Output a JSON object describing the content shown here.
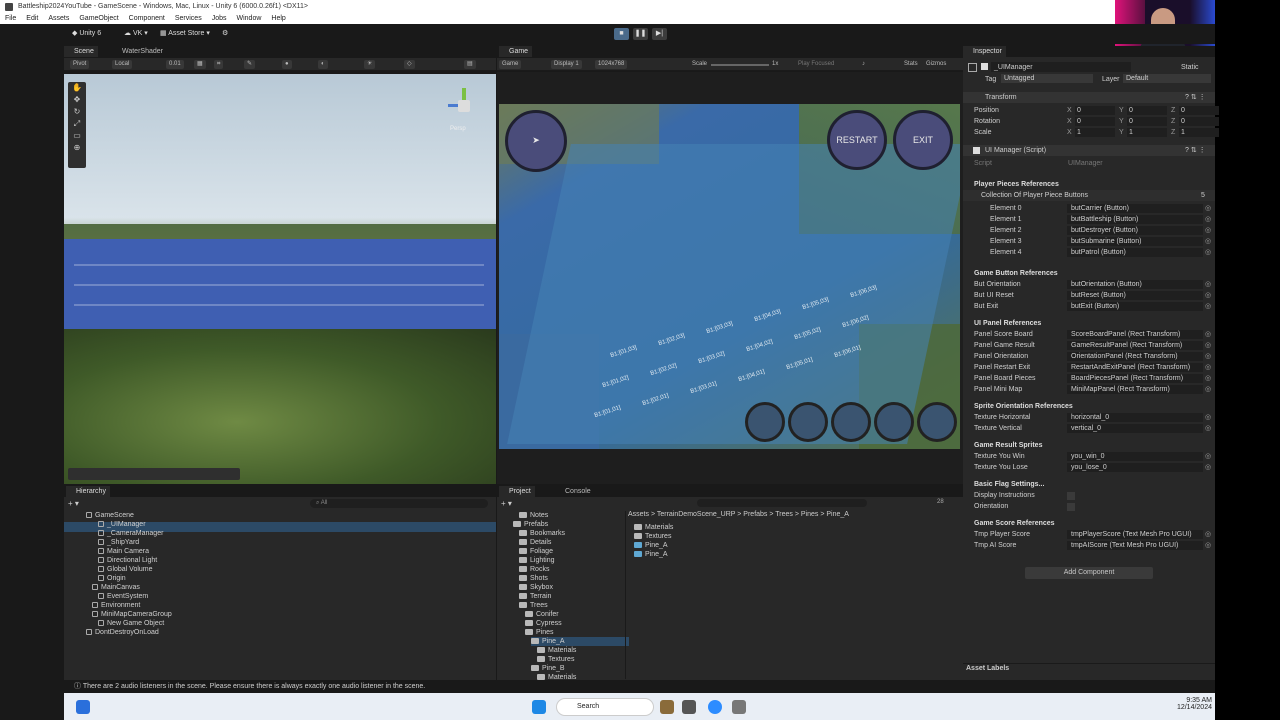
{
  "window": {
    "title": "Battleship2024YouTube - GameScene - Windows, Mac, Linux - Unity 6 (6000.0.26f1) <DX11>"
  },
  "menu": [
    "File",
    "Edit",
    "Assets",
    "GameObject",
    "Component",
    "Services",
    "Jobs",
    "Window",
    "Help"
  ],
  "toolbar": {
    "unity_label": "Unity 6",
    "account_label": "VK",
    "asset_store_label": "Asset Store"
  },
  "scene_tabs": {
    "scene": "Scene",
    "water_shader": "WaterShader"
  },
  "scene_toolbar": {
    "pivot": "Pivot",
    "local": "Local",
    "snap": "0.01",
    "persp": "Persp"
  },
  "game_tab": "Game",
  "game_toolbar": {
    "mode": "Game",
    "display": "Display 1",
    "resolution": "1024x768",
    "scale_label": "Scale",
    "scale_value": "1x",
    "play_focused": "Play Focused",
    "stats": "Stats",
    "gizmos": "Gizmos"
  },
  "game_ui": {
    "restart_label": "RESTART",
    "exit_label": "EXIT"
  },
  "grid_labels": [
    "B1:[01,01]",
    "B1:[02,01]",
    "B1:[03,01]",
    "B1:[04,01]",
    "B1:[05,01]",
    "B1:[06,01]",
    "B1:[01,02]",
    "B1:[02,02]",
    "B1:[03,02]",
    "B1:[04,02]",
    "B1:[05,02]",
    "B1:[06,02]",
    "B1:[01,03]",
    "B1:[02,03]",
    "B1:[03,03]",
    "B1:[04,03]",
    "B1:[05,03]",
    "B1:[06,03]"
  ],
  "hierarchy": {
    "tab": "Hierarchy",
    "search_placeholder": "All",
    "items": [
      {
        "label": "GameScene",
        "indent": 0
      },
      {
        "label": "_UIManager",
        "indent": 2
      },
      {
        "label": "_CameraManager",
        "indent": 2
      },
      {
        "label": "_ShipYard",
        "indent": 2
      },
      {
        "label": "Main Camera",
        "indent": 2
      },
      {
        "label": "Directional Light",
        "indent": 2
      },
      {
        "label": "Global Volume",
        "indent": 2
      },
      {
        "label": "Origin",
        "indent": 2
      },
      {
        "label": "MainCanvas",
        "indent": 1
      },
      {
        "label": "EventSystem",
        "indent": 2
      },
      {
        "label": "Environment",
        "indent": 1
      },
      {
        "label": "MiniMapCameraGroup",
        "indent": 1
      },
      {
        "label": "New Game Object",
        "indent": 2
      },
      {
        "label": "DontDestroyOnLoad",
        "indent": 0
      }
    ]
  },
  "project": {
    "tab": "Project",
    "console_tab": "Console",
    "breadcrumb": "Assets > TerrainDemoScene_URP > Prefabs > Trees > Pines > Pine_A",
    "tree": [
      {
        "label": "Notes",
        "indent": 2
      },
      {
        "label": "Prefabs",
        "indent": 1
      },
      {
        "label": "Bookmarks",
        "indent": 2
      },
      {
        "label": "Details",
        "indent": 2
      },
      {
        "label": "Foliage",
        "indent": 2
      },
      {
        "label": "Lighting",
        "indent": 2
      },
      {
        "label": "Rocks",
        "indent": 2
      },
      {
        "label": "Shots",
        "indent": 2
      },
      {
        "label": "Skybox",
        "indent": 2
      },
      {
        "label": "Terrain",
        "indent": 2
      },
      {
        "label": "Trees",
        "indent": 2
      },
      {
        "label": "Conifer",
        "indent": 3
      },
      {
        "label": "Cypress",
        "indent": 3
      },
      {
        "label": "Pines",
        "indent": 3
      },
      {
        "label": "Pine_A",
        "indent": 4
      },
      {
        "label": "Materials",
        "indent": 5
      },
      {
        "label": "Textures",
        "indent": 5
      },
      {
        "label": "Pine_B",
        "indent": 4
      },
      {
        "label": "Materials",
        "indent": 5
      }
    ],
    "files": [
      "Materials",
      "Textures",
      "Pine_A",
      "Pine_A"
    ],
    "count_badge": "28"
  },
  "inspector": {
    "tab": "Inspector",
    "object_name": "_UIManager",
    "static_label": "Static",
    "tag_label": "Tag",
    "tag_value": "Untagged",
    "layer_label": "Layer",
    "layer_value": "Default",
    "transform": {
      "title": "Transform",
      "rows": [
        {
          "label": "Position",
          "x": "0",
          "y": "0",
          "z": "0"
        },
        {
          "label": "Rotation",
          "x": "0",
          "y": "0",
          "z": "0"
        },
        {
          "label": "Scale",
          "x": "1",
          "y": "1",
          "z": "1"
        }
      ]
    },
    "script": {
      "title": "UI Manager (Script)",
      "script_label": "Script",
      "script_value": "UIManager"
    },
    "player_pieces": {
      "header": "Player Pieces References",
      "collection_label": "Collection Of Player Piece Buttons",
      "collection_count": "5",
      "elements": [
        {
          "label": "Element 0",
          "value": "butCarrier (Button)"
        },
        {
          "label": "Element 1",
          "value": "butBattleship (Button)"
        },
        {
          "label": "Element 2",
          "value": "butDestroyer (Button)"
        },
        {
          "label": "Element 3",
          "value": "butSubmarine (Button)"
        },
        {
          "label": "Element 4",
          "value": "butPatrol (Button)"
        }
      ]
    },
    "game_buttons": {
      "header": "Game Button References",
      "rows": [
        {
          "label": "But Orientation",
          "value": "butOrientation (Button)"
        },
        {
          "label": "But UI Reset",
          "value": "butReset (Button)"
        },
        {
          "label": "But Exit",
          "value": "butExit (Button)"
        }
      ]
    },
    "ui_panels": {
      "header": "UI Panel References",
      "rows": [
        {
          "label": "Panel Score Board",
          "value": "ScoreBoardPanel (Rect Transform)"
        },
        {
          "label": "Panel Game Result",
          "value": "GameResultPanel (Rect Transform)"
        },
        {
          "label": "Panel Orientation",
          "value": "OrientationPanel (Rect Transform)"
        },
        {
          "label": "Panel Restart Exit",
          "value": "RestartAndExitPanel (Rect Transform)"
        },
        {
          "label": "Panel Board Pieces",
          "value": "BoardPiecesPanel (Rect Transform)"
        },
        {
          "label": "Panel Mini Map",
          "value": "MiniMapPanel (Rect Transform)"
        }
      ]
    },
    "sprite_orientation": {
      "header": "Sprite Orientation References",
      "rows": [
        {
          "label": "Texture Horizontal",
          "value": "horizontal_0"
        },
        {
          "label": "Texture Vertical",
          "value": "vertical_0"
        }
      ]
    },
    "game_result": {
      "header": "Game Result Sprites",
      "rows": [
        {
          "label": "Texture You Win",
          "value": "you_win_0"
        },
        {
          "label": "Texture You Lose",
          "value": "you_lose_0"
        }
      ]
    },
    "basic_flags": {
      "header": "Basic Flag Settings...",
      "rows": [
        {
          "label": "Display Instructions"
        },
        {
          "label": "Orientation"
        }
      ]
    },
    "game_score": {
      "header": "Game Score References",
      "rows": [
        {
          "label": "Tmp Player Score",
          "value": "tmpPlayerScore (Text Mesh Pro UGUI)"
        },
        {
          "label": "Tmp AI Score",
          "value": "tmpAIScore (Text Mesh Pro UGUI)"
        }
      ]
    },
    "add_component": "Add Component",
    "asset_labels": "Asset Labels"
  },
  "status_message": "There are 2 audio listeners in the scene. Please ensure there is always exactly one audio listener in the scene.",
  "taskbar": {
    "search": "Search",
    "time": "9:35 AM",
    "date": "12/14/2024"
  },
  "colors": {
    "accent": "#2c5d87",
    "panel": "#282828",
    "bg": "#191919"
  }
}
